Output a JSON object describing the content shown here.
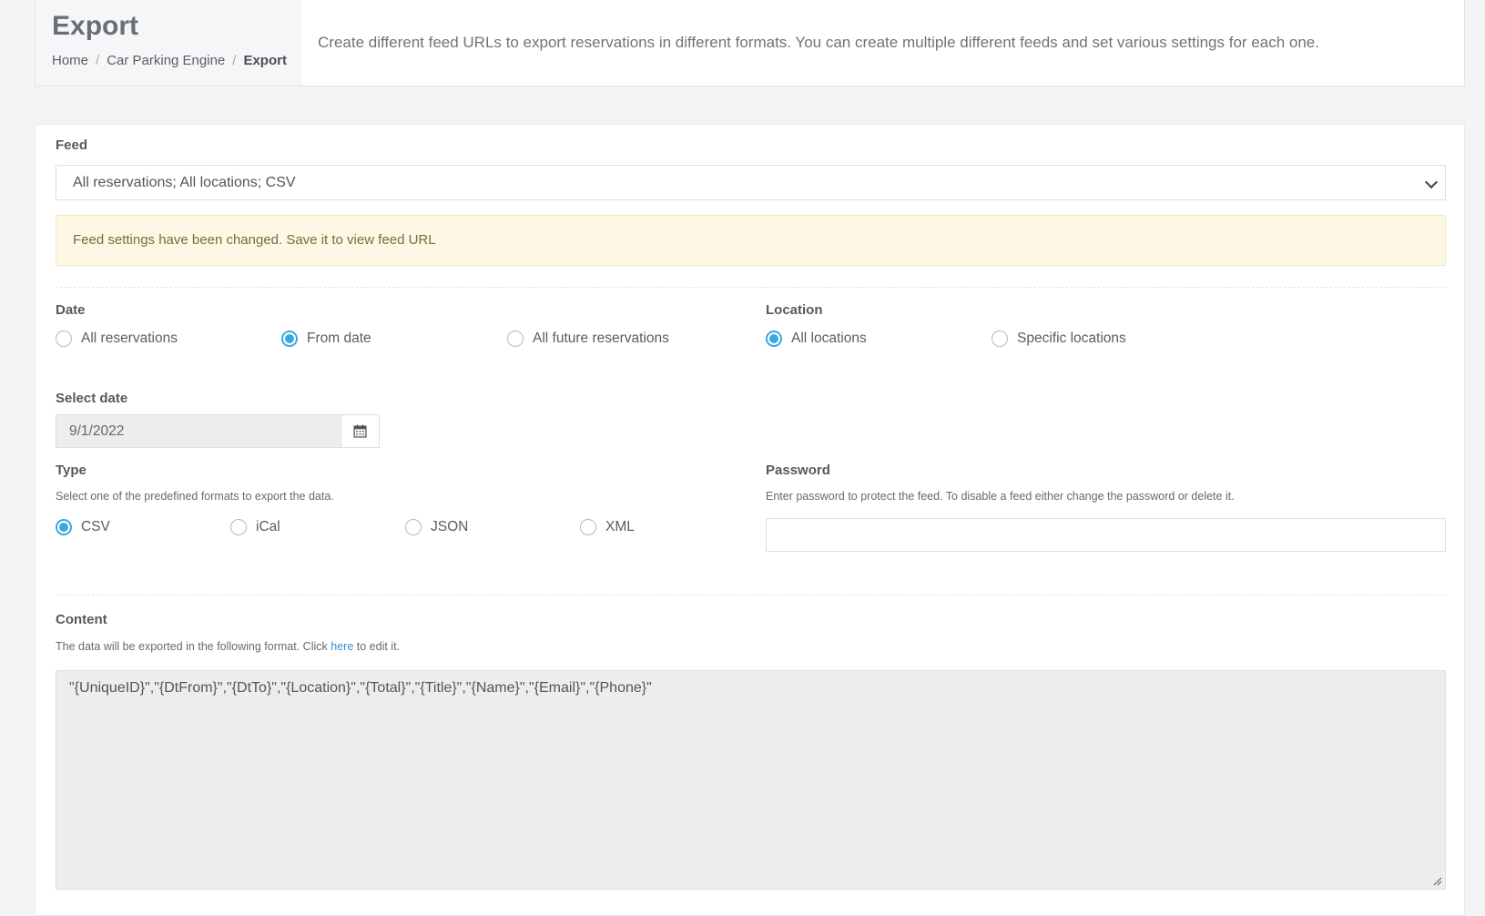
{
  "header": {
    "title": "Export",
    "breadcrumb": [
      "Home",
      "Car Parking Engine",
      "Export"
    ],
    "description": "Create different feed URLs to export reservations in different formats. You can create multiple different feeds and set various settings for each one."
  },
  "feed": {
    "label": "Feed",
    "selected": "All reservations; All locations; CSV"
  },
  "alert": "Feed settings have been changed. Save it to view feed URL",
  "date": {
    "label": "Date",
    "options": [
      "All reservations",
      "From date",
      "All future reservations"
    ],
    "selected": "From date"
  },
  "location": {
    "label": "Location",
    "options": [
      "All locations",
      "Specific locations"
    ],
    "selected": "All locations"
  },
  "select_date": {
    "label": "Select date",
    "value": "9/1/2022",
    "icon": "calendar-icon"
  },
  "type": {
    "label": "Type",
    "help": "Select one of the predefined formats to export the data.",
    "options": [
      "CSV",
      "iCal",
      "JSON",
      "XML"
    ],
    "selected": "CSV"
  },
  "password": {
    "label": "Password",
    "help": "Enter password to protect the feed. To disable a feed either change the password or delete it.",
    "value": ""
  },
  "content": {
    "label": "Content",
    "help_prefix": "The data will be exported in the following format. Click",
    "help_link": "here",
    "help_suffix": "to edit it.",
    "value": "\"{UniqueID}\",\"{DtFrom}\",\"{DtTo}\",\"{Location}\",\"{Total}\",\"{Title}\",\"{Name}\",\"{Email}\",\"{Phone}\""
  },
  "colors": {
    "accent": "#3ba9dd",
    "alert_bg": "#fdf8e6",
    "link": "#3b8fd0"
  }
}
